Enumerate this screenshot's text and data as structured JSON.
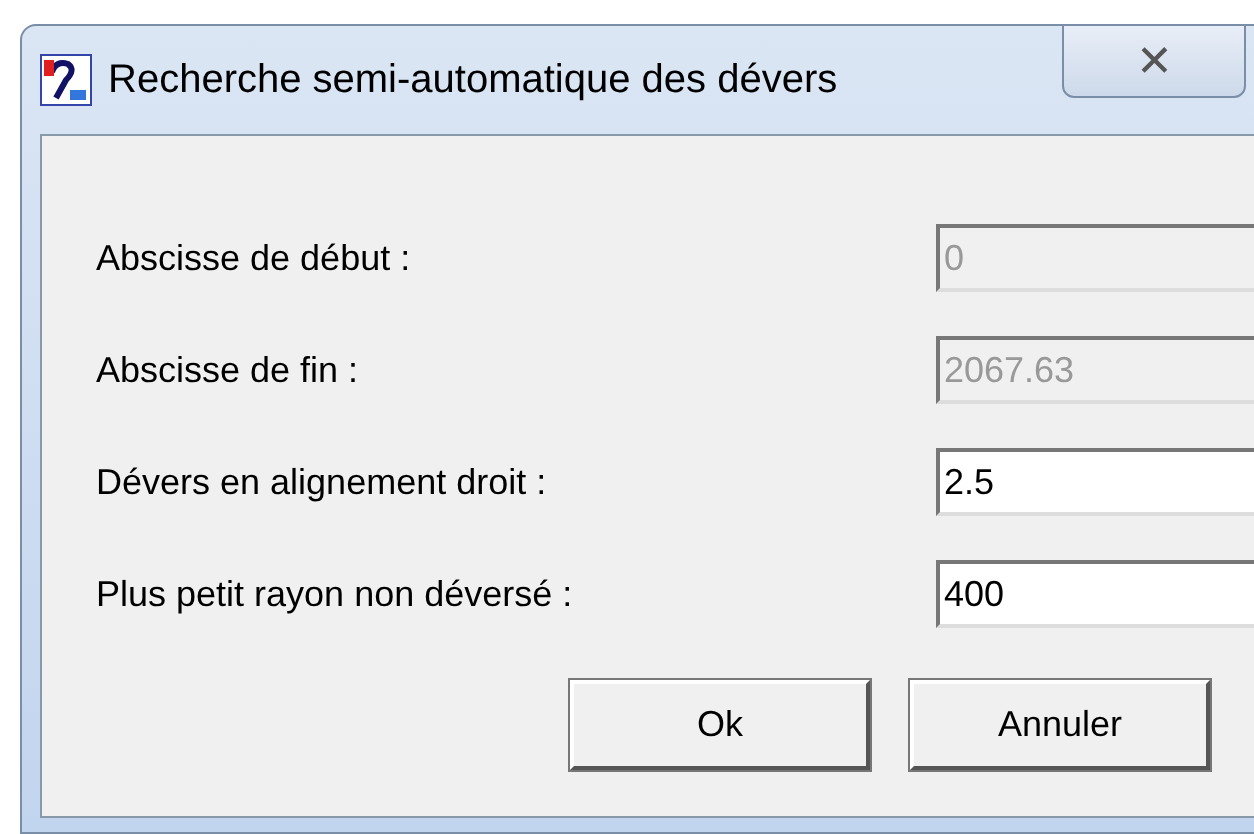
{
  "window": {
    "title": "Recherche semi-automatique des dévers",
    "close_label": "✕"
  },
  "fields": [
    {
      "label": "Abscisse de début :",
      "value": "0",
      "disabled": true
    },
    {
      "label": "Abscisse de fin :",
      "value": "2067.63",
      "disabled": true
    },
    {
      "label": "Dévers en alignement droit :",
      "value": "2.5",
      "disabled": false
    },
    {
      "label": "Plus petit rayon non déversé :",
      "value": "400",
      "disabled": false
    }
  ],
  "buttons": [
    "Ok",
    "Annuler"
  ]
}
